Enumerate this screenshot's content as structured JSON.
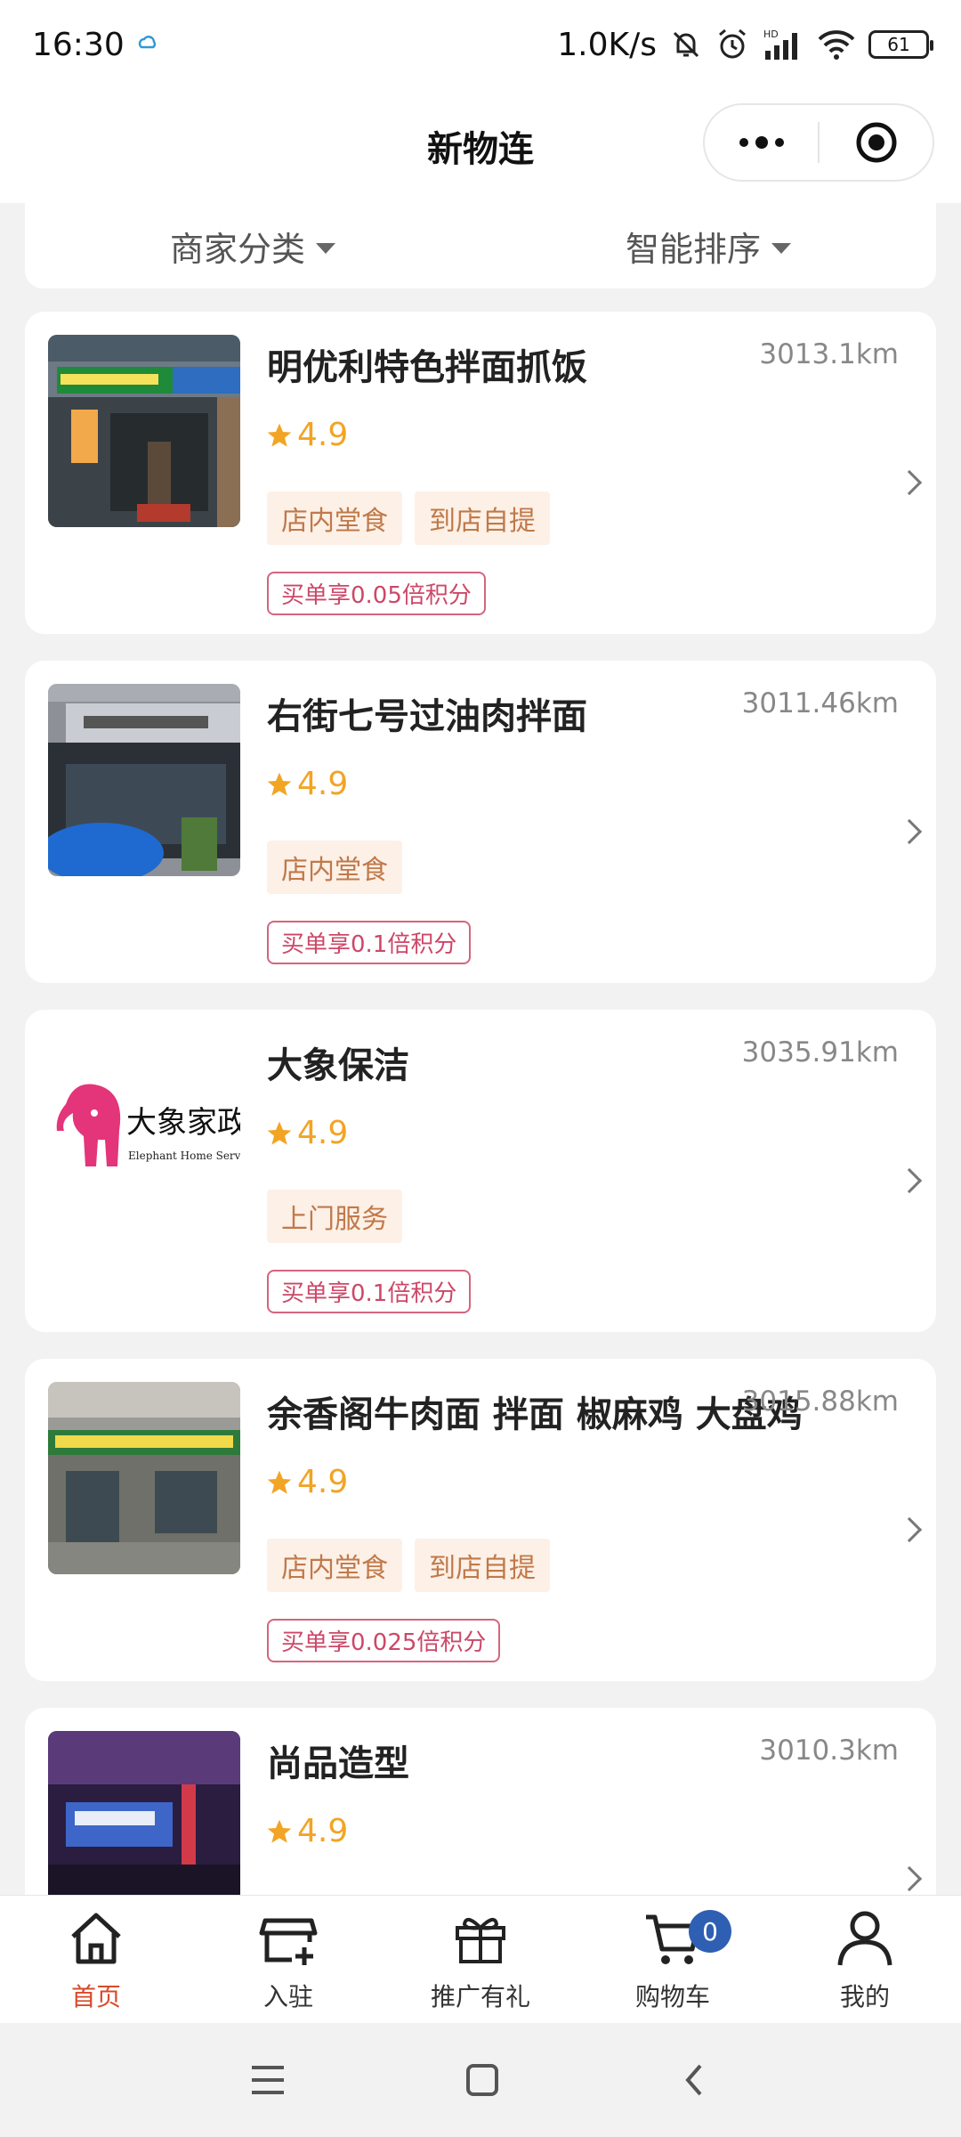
{
  "status_bar": {
    "time": "16:30",
    "net_speed": "1.0K/s",
    "battery": "61",
    "hd_label": "HD"
  },
  "nav": {
    "title": "新物连"
  },
  "filters": {
    "category": "商家分类",
    "sort": "智能排序"
  },
  "stores": [
    {
      "name": "明优利特色拌面抓饭",
      "distance": "3013.1km",
      "rating": "4.9",
      "tags": [
        "店内堂食",
        "到店自提"
      ],
      "promo": "买单享0.05倍积分",
      "image_icon": "storefront-photo"
    },
    {
      "name": "右街七号过油肉拌面",
      "distance": "3011.46km",
      "rating": "4.9",
      "tags": [
        "店内堂食"
      ],
      "promo": "买单享0.1倍积分",
      "image_icon": "storefront-photo"
    },
    {
      "name": "大象保洁",
      "distance": "3035.91km",
      "rating": "4.9",
      "tags": [
        "上门服务"
      ],
      "promo": "买单享0.1倍积分",
      "image_icon": "elephant-logo",
      "logo_text": "大象家政",
      "logo_subtext": "Elephant Home Service"
    },
    {
      "name": "余香阁牛肉面 拌面 椒麻鸡 大盘鸡",
      "distance": "3015.88km",
      "rating": "4.9",
      "tags": [
        "店内堂食",
        "到店自提"
      ],
      "promo": "买单享0.025倍积分",
      "image_icon": "storefront-photo"
    },
    {
      "name": "尚品造型",
      "distance": "3010.3km",
      "rating": "4.9",
      "tags": [],
      "promo": "",
      "image_icon": "storefront-photo"
    }
  ],
  "tabs": [
    {
      "label": "首页",
      "icon": "home-icon",
      "active": true
    },
    {
      "label": "入驻",
      "icon": "store-add-icon",
      "active": false
    },
    {
      "label": "推广有礼",
      "icon": "gift-icon",
      "active": false
    },
    {
      "label": "购物车",
      "icon": "cart-icon",
      "active": false,
      "badge": "0"
    },
    {
      "label": "我的",
      "icon": "user-icon",
      "active": false
    }
  ],
  "colors": {
    "accent_red": "#d84a2b",
    "star": "#f2a424",
    "badge_blue": "#2f5fb3",
    "promo_border": "#d4657f"
  }
}
